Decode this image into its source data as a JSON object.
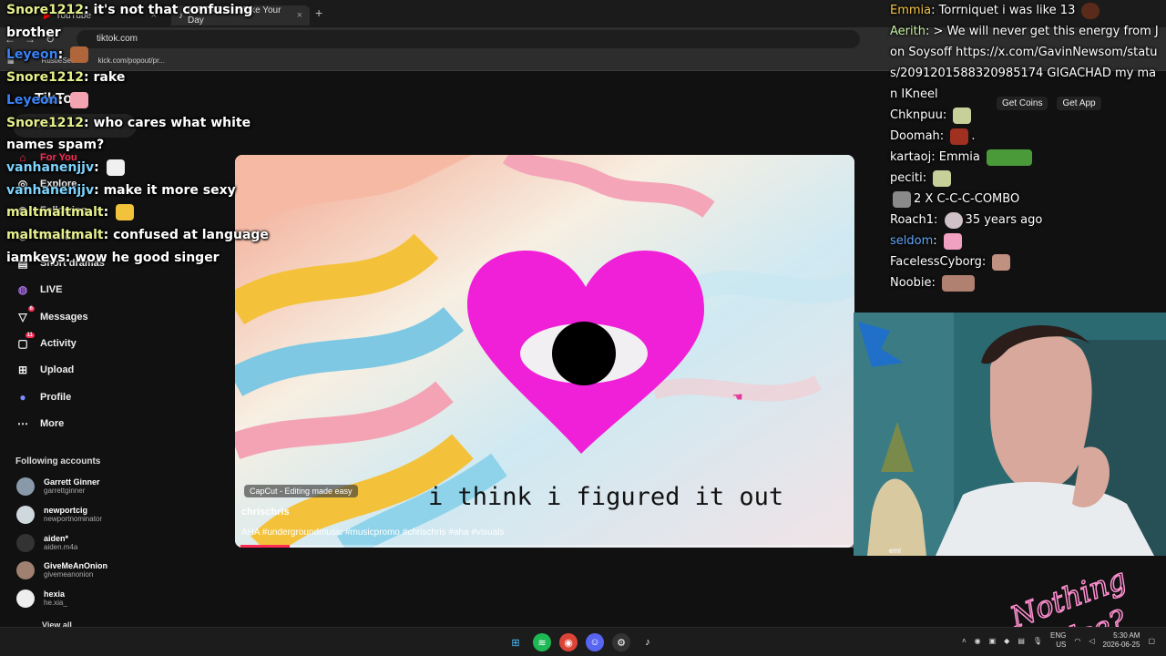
{
  "browser": {
    "tabs": [
      {
        "label": "YouTube"
      },
      {
        "label": "(17)TikTok - Make Your Day"
      }
    ],
    "new_tab": "+",
    "url": "tiktok.com",
    "bookmarks": [
      "RustleSearch",
      "kick.com/popout/pr..."
    ]
  },
  "tiktok": {
    "logo": "TikTok",
    "search_placeholder": "Search",
    "nav": [
      {
        "label": "For You",
        "icon": "home-icon"
      },
      {
        "label": "Explore",
        "icon": "compass-icon"
      },
      {
        "label": "Following",
        "icon": "following-icon"
      },
      {
        "label": "Friends",
        "icon": "friends-icon"
      },
      {
        "label": "Short dramas",
        "icon": "dramas-icon"
      },
      {
        "label": "LIVE",
        "icon": "live-icon"
      },
      {
        "label": "Messages",
        "icon": "messages-icon",
        "badge": "6"
      },
      {
        "label": "Activity",
        "icon": "activity-icon",
        "badge": "11"
      },
      {
        "label": "Upload",
        "icon": "upload-icon"
      },
      {
        "label": "Profile",
        "icon": "profile-icon"
      },
      {
        "label": "More",
        "icon": "more-icon"
      }
    ],
    "following_title": "Following accounts",
    "accounts": [
      {
        "name": "Garrett Ginner",
        "handle": "garrettginner",
        "color": "#8899aa"
      },
      {
        "name": "newportcig",
        "handle": "newportnominator",
        "color": "#cfd8dc"
      },
      {
        "name": "aiden*",
        "handle": "aiden.m4a",
        "color": "#333333"
      },
      {
        "name": "GiveMeAnOnion",
        "handle": "givemeanonion",
        "color": "#a08070"
      },
      {
        "name": "hexia",
        "handle": "he.xia_",
        "color": "#eeeeee"
      }
    ],
    "view_all": "View all",
    "top_buttons": [
      "Get Coins",
      "Get App"
    ],
    "video": {
      "capcut_label": "CapCut - Editing made easy",
      "caption": "i think i figured it out",
      "author": "chrischris",
      "tags": "AHA #undergroundmusic #musicpromo #chrischris #aha #visuals",
      "progress": 0.08
    }
  },
  "chat_left": [
    {
      "user": "Snore1212",
      "color": "#e6f08c",
      "text": "it's not that confusing brother"
    },
    {
      "user": "Leyeon",
      "color": "#3b82f6",
      "text": ""
    },
    {
      "user": "Snore1212",
      "color": "#e6f08c",
      "text": "rake"
    },
    {
      "user": "Leyeon",
      "color": "#3b82f6",
      "text": ""
    },
    {
      "user": "Snore1212",
      "color": "#e6f08c",
      "text": "who cares what white names spam?"
    },
    {
      "user": "vanhanenjjv",
      "color": "#7dd3fc",
      "text": ""
    },
    {
      "user": "vanhanenjjv",
      "color": "#7dd3fc",
      "text": "make it more sexy"
    },
    {
      "user": "maltmaltmalt",
      "color": "#e6f08c",
      "text": ""
    },
    {
      "user": "maltmaltmalt",
      "color": "#e6f08c",
      "text": "confused at language"
    },
    {
      "user": "iamkeys",
      "color": "#ffffff",
      "text": "wow he good singer"
    }
  ],
  "chat_right": [
    {
      "user": "Emmia",
      "color": "#f5c542",
      "text": "Torrniquet i was like 13"
    },
    {
      "user": "Aerith",
      "color": "#c4f0a0",
      "text": "> We will never get this energy from Jon Soysoff https://x.com/GavinNewsom/status/2091201588320985174 GIGACHAD my man IKneel"
    },
    {
      "user": "Chknpuu",
      "color": "#ffffff",
      "text": ""
    },
    {
      "user": "Doomah",
      "color": "#ffffff",
      "text": "."
    },
    {
      "user": "kartaoj",
      "color": "#ffffff",
      "text": "Emmia"
    },
    {
      "user": "peciti",
      "color": "#ffffff",
      "text": ""
    },
    {
      "user": "",
      "color": "#ffffff",
      "text": "2 X C-C-C-COMBO"
    },
    {
      "user": "Roach1",
      "color": "#ffffff",
      "text": "35 years ago"
    },
    {
      "user": "seldom",
      "color": "#60a5fa",
      "text": ""
    },
    {
      "user": "FacelessCyborg",
      "color": "#ffffff",
      "text": ""
    },
    {
      "user": "Noobie",
      "color": "#ffffff",
      "text": ""
    }
  ],
  "webcam": {
    "label": "emi",
    "overlay_text": "Nothing Else?"
  },
  "taskbar": {
    "apps": [
      "windows-start-icon",
      "spotify-icon",
      "chrome-icon",
      "discord-icon",
      "steam-icon",
      "tiktok-icon"
    ],
    "lang": "ENG",
    "region": "US",
    "time": "5:30 AM",
    "date": "2026-06-25"
  }
}
